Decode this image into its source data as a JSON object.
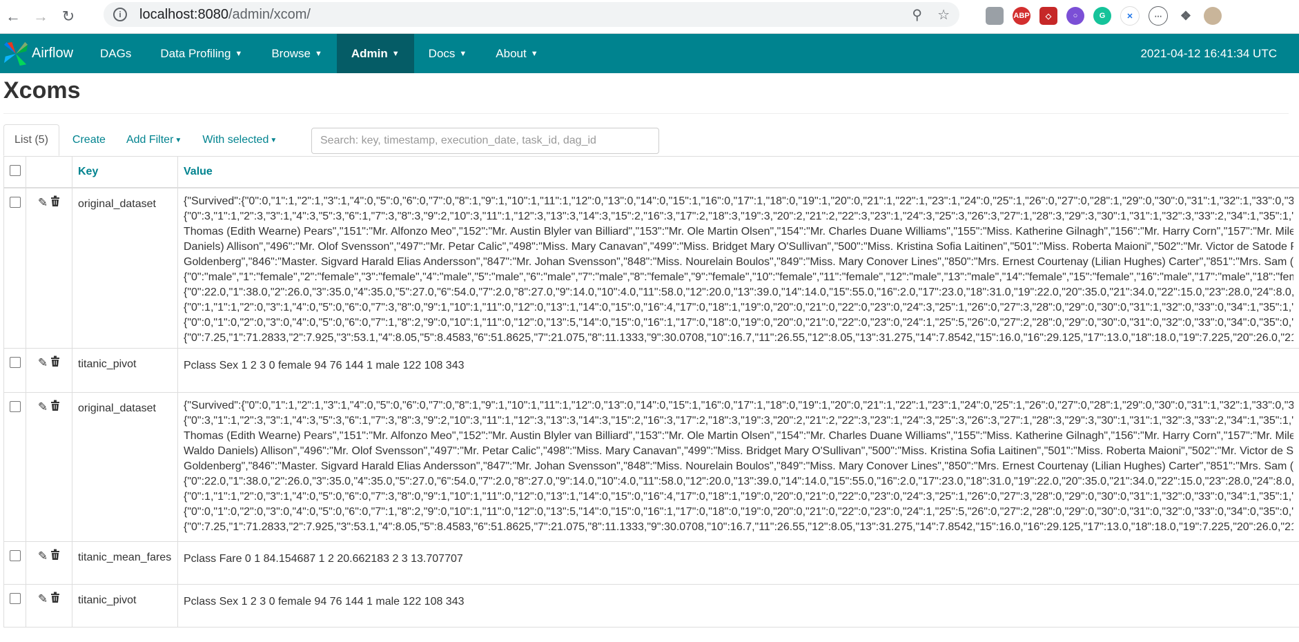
{
  "browser": {
    "url_host": "localhost:8080",
    "url_path": "/admin/xcom/",
    "icons": [
      "back-icon",
      "forward-icon",
      "reload-icon",
      "info-icon",
      "zoom-icon",
      "star-icon"
    ],
    "extensions": [
      "profile-ext",
      "ABP",
      "pdf-ext",
      "ext-purple",
      "grammarly-ext",
      "ext-yellow",
      "ext-bracket",
      "puzzle-icon",
      "avatar"
    ]
  },
  "navbar": {
    "brand": "Airflow",
    "items": [
      {
        "label": "DAGs",
        "dropdown": false
      },
      {
        "label": "Data Profiling",
        "dropdown": true
      },
      {
        "label": "Browse",
        "dropdown": true
      },
      {
        "label": "Admin",
        "dropdown": true,
        "active": true
      },
      {
        "label": "Docs",
        "dropdown": true
      },
      {
        "label": "About",
        "dropdown": true
      }
    ],
    "clock": "2021-04-12 16:41:34 UTC",
    "color": "#00838f"
  },
  "page": {
    "title": "Xcoms",
    "tab_list": "List (5)",
    "create": "Create",
    "add_filter": "Add Filter",
    "with_selected": "With selected",
    "search_placeholder": "Search: key, timestamp, execution_date, task_id, dag_id"
  },
  "table": {
    "headers": {
      "key": "Key",
      "value": "Value"
    },
    "rows": [
      {
        "key": "original_dataset",
        "lines": [
          "{\"Survived\":{\"0\":0,\"1\":1,\"2\":1,\"3\":1,\"4\":0,\"5\":0,\"6\":0,\"7\":0,\"8\":1,\"9\":1,\"10\":1,\"11\":1,\"12\":0,\"13\":0,\"14\":0,\"15\":1,\"16\":0,\"17\":1,\"18\":0,\"19\":1,\"20\":0,\"21\":1,\"22\":1,\"23\":1,\"24\":0,\"25\":1,\"26\":0,\"27\":0,\"28\":1,\"29\":0,\"30\":0,\"31\":1,\"32\":1,\"33\":0,\"34\"",
          "{\"0\":3,\"1\":1,\"2\":3,\"3\":1,\"4\":3,\"5\":3,\"6\":1,\"7\":3,\"8\":3,\"9\":2,\"10\":3,\"11\":1,\"12\":3,\"13\":3,\"14\":3,\"15\":2,\"16\":3,\"17\":2,\"18\":3,\"19\":3,\"20\":2,\"21\":2,\"22\":3,\"23\":1,\"24\":3,\"25\":3,\"26\":3,\"27\":1,\"28\":3,\"29\":3,\"30\":1,\"31\":1,\"32\":3,\"33\":2,\"34\":1,\"35\":1,\"36",
          "Thomas (Edith Wearne) Pears\",\"151\":\"Mr. Alfonzo Meo\",\"152\":\"Mr. Austin Blyler van Billiard\",\"153\":\"Mr. Ole Martin Olsen\",\"154\":\"Mr. Charles Duane Williams\",\"155\":\"Miss. Katherine Gilnagh\",\"156\":\"Mr. Harry Corn\",\"157\":\"Mr. Mile S",
          "Daniels) Allison\",\"496\":\"Mr. Olof Svensson\",\"497\":\"Mr. Petar Calic\",\"498\":\"Miss. Mary Canavan\",\"499\":\"Miss. Bridget Mary O'Sullivan\",\"500\":\"Miss. Kristina Sofia Laitinen\",\"501\":\"Miss. Roberta Maioni\",\"502\":\"Mr. Victor de Satode Pe",
          "Goldenberg\",\"846\":\"Master. Sigvard Harald Elias Andersson\",\"847\":\"Mr. Johan Svensson\",\"848\":\"Miss. Nourelain Boulos\",\"849\":\"Miss. Mary Conover Lines\",\"850\":\"Mrs. Ernest Courtenay (Lilian Hughes) Carter\",\"851\":\"Mrs. Sam (Le",
          "{\"0\":\"male\",\"1\":\"female\",\"2\":\"female\",\"3\":\"female\",\"4\":\"male\",\"5\":\"male\",\"6\":\"male\",\"7\":\"male\",\"8\":\"female\",\"9\":\"female\",\"10\":\"female\",\"11\":\"female\",\"12\":\"male\",\"13\":\"male\",\"14\":\"female\",\"15\":\"female\",\"16\":\"male\",\"17\":\"male\",\"18\":\"fema",
          "{\"0\":22.0,\"1\":38.0,\"2\":26.0,\"3\":35.0,\"4\":35.0,\"5\":27.0,\"6\":54.0,\"7\":2.0,\"8\":27.0,\"9\":14.0,\"10\":4.0,\"11\":58.0,\"12\":20.0,\"13\":39.0,\"14\":14.0,\"15\":55.0,\"16\":2.0,\"17\":23.0,\"18\":31.0,\"19\":22.0,\"20\":35.0,\"21\":34.0,\"22\":15.0,\"23\":28.0,\"24\":8.0,\"2",
          "{\"0\":1,\"1\":1,\"2\":0,\"3\":1,\"4\":0,\"5\":0,\"6\":0,\"7\":3,\"8\":0,\"9\":1,\"10\":1,\"11\":0,\"12\":0,\"13\":1,\"14\":0,\"15\":0,\"16\":4,\"17\":0,\"18\":1,\"19\":0,\"20\":0,\"21\":0,\"22\":0,\"23\":0,\"24\":3,\"25\":1,\"26\":0,\"27\":3,\"28\":0,\"29\":0,\"30\":0,\"31\":1,\"32\":0,\"33\":0,\"34\":1,\"35\":1,\"36",
          "{\"0\":0,\"1\":0,\"2\":0,\"3\":0,\"4\":0,\"5\":0,\"6\":0,\"7\":1,\"8\":2,\"9\":0,\"10\":1,\"11\":0,\"12\":0,\"13\":5,\"14\":0,\"15\":0,\"16\":1,\"17\":0,\"18\":0,\"19\":0,\"20\":0,\"21\":0,\"22\":0,\"23\":0,\"24\":1,\"25\":5,\"26\":0,\"27\":2,\"28\":0,\"29\":0,\"30\":0,\"31\":0,\"32\":0,\"33\":0,\"34\":0,\"35\":0,\"36",
          "{\"0\":7.25,\"1\":71.2833,\"2\":7.925,\"3\":53.1,\"4\":8.05,\"5\":8.4583,\"6\":51.8625,\"7\":21.075,\"8\":11.1333,\"9\":30.0708,\"10\":16.7,\"11\":26.55,\"12\":8.05,\"13\":31.275,\"14\":7.8542,\"15\":16.0,\"16\":29.125,\"17\":13.0,\"18\":18.0,\"19\":7.225,\"20\":26.0,\"21\":"
        ]
      },
      {
        "key": "titanic_pivot",
        "lines": [
          "Pclass Sex 1 2 3 0 female 94 76 144 1 male 122 108 343"
        ]
      },
      {
        "key": "original_dataset",
        "lines": [
          "{\"Survived\":{\"0\":0,\"1\":1,\"2\":1,\"3\":1,\"4\":0,\"5\":0,\"6\":0,\"7\":0,\"8\":1,\"9\":1,\"10\":1,\"11\":1,\"12\":0,\"13\":0,\"14\":0,\"15\":1,\"16\":0,\"17\":1,\"18\":0,\"19\":1,\"20\":0,\"21\":1,\"22\":1,\"23\":1,\"24\":0,\"25\":1,\"26\":0,\"27\":0,\"28\":1,\"29\":0,\"30\":0,\"31\":1,\"32\":1,\"33\":0,\"34\"",
          "{\"0\":3,\"1\":1,\"2\":3,\"3\":1,\"4\":3,\"5\":3,\"6\":1,\"7\":3,\"8\":3,\"9\":2,\"10\":3,\"11\":1,\"12\":3,\"13\":3,\"14\":3,\"15\":2,\"16\":3,\"17\":2,\"18\":3,\"19\":3,\"20\":2,\"21\":2,\"22\":3,\"23\":1,\"24\":3,\"25\":3,\"26\":3,\"27\":1,\"28\":3,\"29\":3,\"30\":1,\"31\":1,\"32\":3,\"33\":2,\"34\":1,\"35\":1,\"36",
          "Thomas (Edith Wearne) Pears\",\"151\":\"Mr. Alfonzo Meo\",\"152\":\"Mr. Austin Blyler van Billiard\",\"153\":\"Mr. Ole Martin Olsen\",\"154\":\"Mr. Charles Duane Williams\",\"155\":\"Miss. Katherine Gilnagh\",\"156\":\"Mr. Harry Corn\",\"157\":\"Mr. Mile S",
          "Waldo Daniels) Allison\",\"496\":\"Mr. Olof Svensson\",\"497\":\"Mr. Petar Calic\",\"498\":\"Miss. Mary Canavan\",\"499\":\"Miss. Bridget Mary O'Sullivan\",\"500\":\"Miss. Kristina Sofia Laitinen\",\"501\":\"Miss. Roberta Maioni\",\"502\":\"Mr. Victor de Sat",
          "Goldenberg\",\"846\":\"Master. Sigvard Harald Elias Andersson\",\"847\":\"Mr. Johan Svensson\",\"848\":\"Miss. Nourelain Boulos\",\"849\":\"Miss. Mary Conover Lines\",\"850\":\"Mrs. Ernest Courtenay (Lilian Hughes) Carter\",\"851\":\"Mrs. Sam (Le",
          "{\"0\":22.0,\"1\":38.0,\"2\":26.0,\"3\":35.0,\"4\":35.0,\"5\":27.0,\"6\":54.0,\"7\":2.0,\"8\":27.0,\"9\":14.0,\"10\":4.0,\"11\":58.0,\"12\":20.0,\"13\":39.0,\"14\":14.0,\"15\":55.0,\"16\":2.0,\"17\":23.0,\"18\":31.0,\"19\":22.0,\"20\":35.0,\"21\":34.0,\"22\":15.0,\"23\":28.0,\"24\":8.0,\"2",
          "{\"0\":1,\"1\":1,\"2\":0,\"3\":1,\"4\":0,\"5\":0,\"6\":0,\"7\":3,\"8\":0,\"9\":1,\"10\":1,\"11\":0,\"12\":0,\"13\":1,\"14\":0,\"15\":0,\"16\":4,\"17\":0,\"18\":1,\"19\":0,\"20\":0,\"21\":0,\"22\":0,\"23\":0,\"24\":3,\"25\":1,\"26\":0,\"27\":3,\"28\":0,\"29\":0,\"30\":0,\"31\":1,\"32\":0,\"33\":0,\"34\":1,\"35\":1,\"36",
          "{\"0\":0,\"1\":0,\"2\":0,\"3\":0,\"4\":0,\"5\":0,\"6\":0,\"7\":1,\"8\":2,\"9\":0,\"10\":1,\"11\":0,\"12\":0,\"13\":5,\"14\":0,\"15\":0,\"16\":1,\"17\":0,\"18\":0,\"19\":0,\"20\":0,\"21\":0,\"22\":0,\"23\":0,\"24\":1,\"25\":5,\"26\":0,\"27\":2,\"28\":0,\"29\":0,\"30\":0,\"31\":0,\"32\":0,\"33\":0,\"34\":0,\"35\":0,\"36",
          "{\"0\":7.25,\"1\":71.2833,\"2\":7.925,\"3\":53.1,\"4\":8.05,\"5\":8.4583,\"6\":51.8625,\"7\":21.075,\"8\":11.1333,\"9\":30.0708,\"10\":16.7,\"11\":26.55,\"12\":8.05,\"13\":31.275,\"14\":7.8542,\"15\":16.0,\"16\":29.125,\"17\":13.0,\"18\":18.0,\"19\":7.225,\"20\":26.0,\"21\":"
        ]
      },
      {
        "key": "titanic_mean_fares",
        "lines": [
          "Pclass Fare 0 1 84.154687 1 2 20.662183 2 3 13.707707"
        ]
      },
      {
        "key": "titanic_pivot",
        "lines": [
          "Pclass Sex 1 2 3 0 female 94 76 144 1 male 122 108 343"
        ]
      }
    ]
  }
}
